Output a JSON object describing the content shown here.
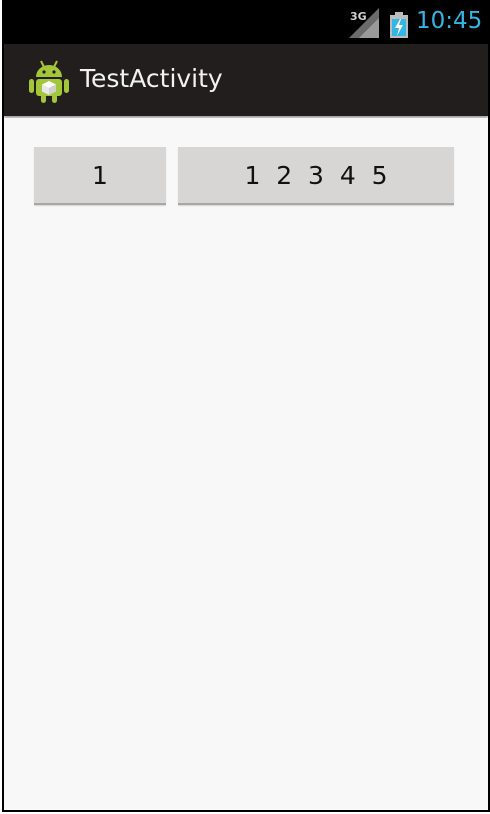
{
  "status_bar": {
    "network_label": "3G",
    "time": "10:45",
    "signal_icon": "signal-strength-icon",
    "battery_icon": "battery-charging-icon",
    "clock_color": "#33b5e5"
  },
  "action_bar": {
    "title": "TestActivity",
    "app_icon": "android-robot-icon",
    "background": "#221e1e"
  },
  "content": {
    "buttons": [
      {
        "label": "1"
      },
      {
        "label": "1  2  3  4  5"
      }
    ]
  }
}
